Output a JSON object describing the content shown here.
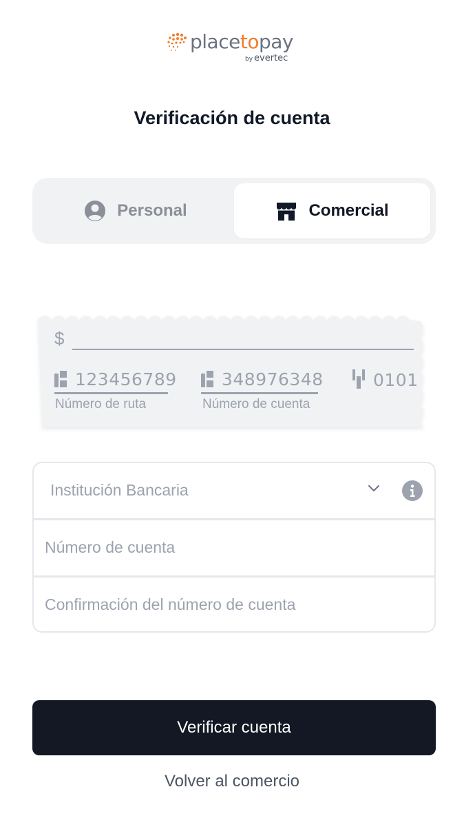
{
  "brand": {
    "name_prefix": "place",
    "name_highlight": "to",
    "name_suffix": "pay",
    "by_prefix": "by",
    "by_name": "evertec",
    "accent_color": "#f07c2e"
  },
  "page": {
    "title": "Verificación de cuenta"
  },
  "account_type": {
    "options": [
      {
        "label": "Personal",
        "icon": "user-circle-icon",
        "selected": false
      },
      {
        "label": "Comercial",
        "icon": "storefront-icon",
        "selected": true
      }
    ]
  },
  "check": {
    "currency_symbol": "$",
    "routing_number": "123456789",
    "routing_label": "Número de ruta",
    "account_number": "348976348",
    "account_label": "Número de cuenta",
    "check_number": "0101"
  },
  "form": {
    "bank_placeholder": "Institución Bancaria",
    "account_placeholder": "Número de cuenta",
    "confirm_placeholder": "Confirmación del número de cuenta"
  },
  "actions": {
    "submit_label": "Verificar cuenta",
    "back_label": "Volver al comercio"
  },
  "colors": {
    "primary_button": "#141824",
    "segment_bg": "#f1f2f4",
    "muted_text": "#9ca3af"
  }
}
